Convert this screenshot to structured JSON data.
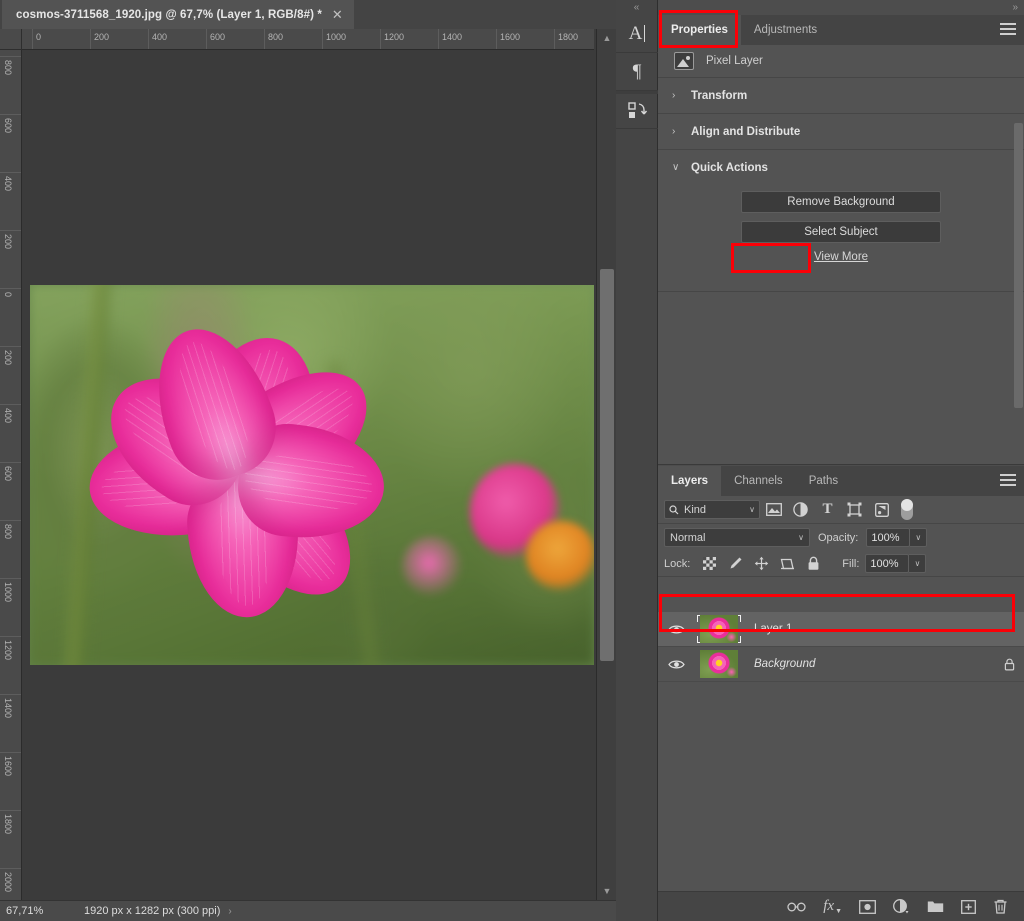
{
  "document": {
    "tab_title": "cosmos-3711568_1920.jpg @ 67,7% (Layer 1, RGB/8#) *",
    "close_icon": "close-icon",
    "ruler_h_ticks": [
      "0",
      "200",
      "400",
      "600",
      "800",
      "1000",
      "1200",
      "1400",
      "1600",
      "1800"
    ],
    "ruler_v_ticks": [
      "800",
      "600",
      "400",
      "200",
      "0",
      "200",
      "400",
      "600",
      "800",
      "1000",
      "1200",
      "1400",
      "1600",
      "1800",
      "2000"
    ]
  },
  "statusbar": {
    "zoom": "67,71%",
    "dimensions": "1920 px x 1282 px (300 ppi)",
    "next_arrow": "›",
    "prev_arrow": "‹"
  },
  "rail": {
    "collapse_icon": "collapse-left-icon",
    "collapse_glyph": "«",
    "items": [
      {
        "name": "character-panel-icon",
        "label": "A"
      },
      {
        "name": "paragraph-panel-icon",
        "label": "¶"
      },
      {
        "name": "libraries-panel-icon",
        "label": ""
      }
    ]
  },
  "right_panel": {
    "expand_glyph": "»",
    "menu_icon": "panel-menu-icon",
    "tabs": [
      {
        "label": "Properties",
        "active": true
      },
      {
        "label": "Adjustments",
        "active": false
      }
    ],
    "properties": {
      "layer_type_label": "Pixel Layer",
      "layer_type_icon": "pixel-layer-icon",
      "sections": [
        {
          "label": "Transform",
          "expanded": false,
          "chevron": "›"
        },
        {
          "label": "Align and Distribute",
          "expanded": false,
          "chevron": "›"
        },
        {
          "label": "Quick Actions",
          "expanded": true,
          "chevron": "∨"
        }
      ],
      "quick_actions": {
        "remove_background": "Remove Background",
        "select_subject": "Select Subject",
        "view_more": "View More"
      }
    }
  },
  "layers_panel": {
    "tabs": [
      {
        "label": "Layers",
        "active": true
      },
      {
        "label": "Channels",
        "active": false
      },
      {
        "label": "Paths",
        "active": false
      }
    ],
    "menu_icon": "panel-menu-icon",
    "filter": {
      "search_icon": "search-icon",
      "kind_label": "Kind",
      "chevron": "∨",
      "icons": [
        "filter-pixel-icon",
        "filter-adjustment-icon",
        "filter-type-icon",
        "filter-shape-icon",
        "filter-smart-object-icon"
      ],
      "toggle_name": "filter-enable-toggle"
    },
    "blend": {
      "mode": "Normal",
      "mode_chevron": "∨",
      "opacity_label": "Opacity:",
      "opacity_value": "100%",
      "opacity_chevron": "∨"
    },
    "lock": {
      "label": "Lock:",
      "icons": [
        "lock-transparent-pixels-icon",
        "lock-image-pixels-icon",
        "lock-position-icon",
        "lock-artboard-nesting-icon",
        "lock-all-icon"
      ],
      "fill_label": "Fill:",
      "fill_value": "100%",
      "fill_chevron": "∨"
    },
    "layers": [
      {
        "name": "Layer 1",
        "visible": true,
        "selected": true,
        "locked": false,
        "italic": false
      },
      {
        "name": "Background",
        "visible": true,
        "selected": false,
        "locked": true,
        "italic": true
      }
    ],
    "footer_icons": [
      "link-layers-icon",
      "layer-style-fx-icon",
      "add-layer-mask-icon",
      "new-adjustment-layer-icon",
      "new-group-icon",
      "new-layer-icon",
      "delete-layer-icon"
    ]
  },
  "annotations": {
    "highlight_color": "#fb0007",
    "boxes": [
      {
        "name": "highlight-properties-tab"
      },
      {
        "name": "highlight-view-more"
      },
      {
        "name": "highlight-layer-1-row"
      }
    ]
  }
}
